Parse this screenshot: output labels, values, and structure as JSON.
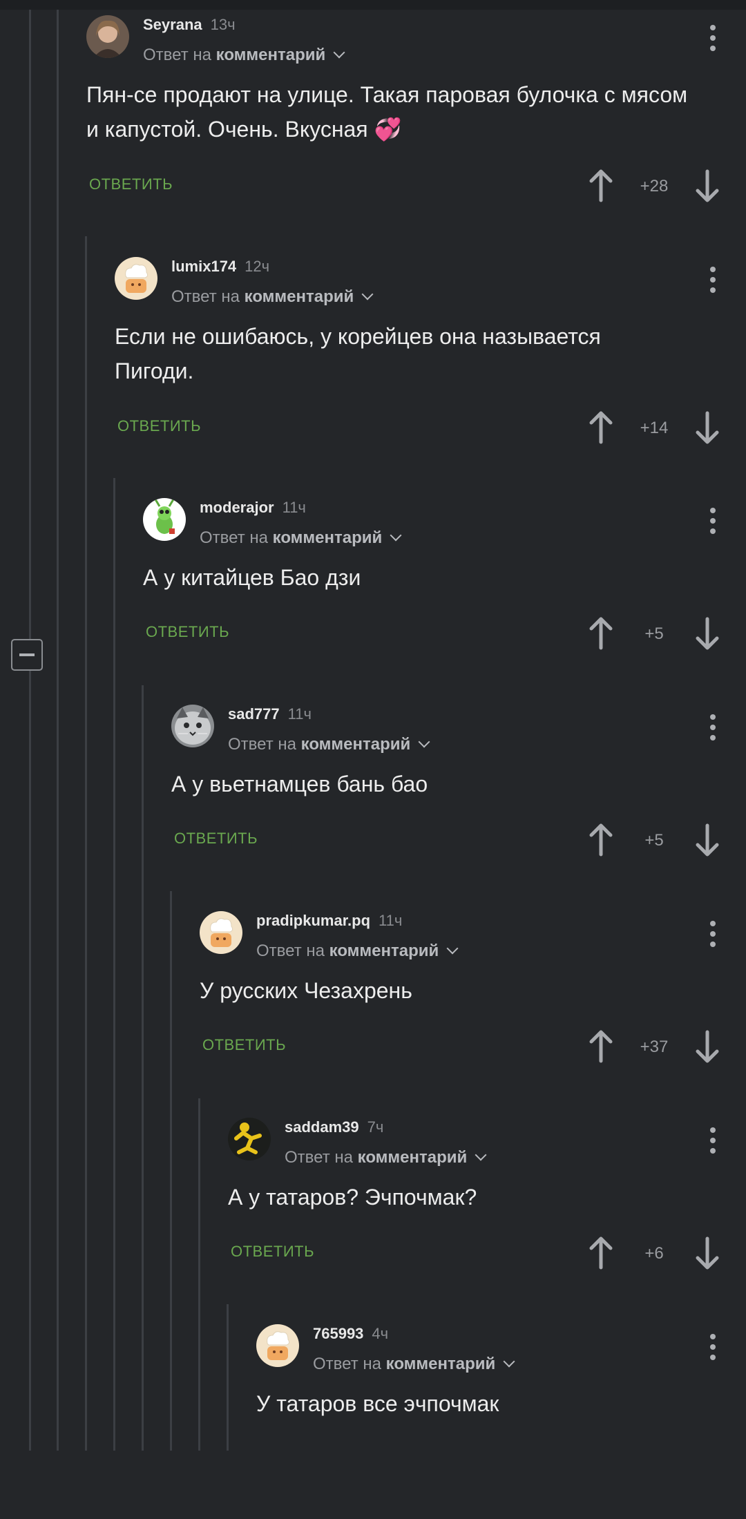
{
  "ui": {
    "reply_prefix": "Ответ на",
    "reply_target": "комментарий",
    "reply_action": "ОТВЕТИТЬ"
  },
  "comments": [
    {
      "username": "Seyrana",
      "time": "13ч",
      "text": "Пян-се продают на улице. Такая паровая булочка с мясом и капустой. Очень. Вкусная 💞",
      "score": "+28",
      "avatar": "woman-photo"
    },
    {
      "username": "lumix174",
      "time": "12ч",
      "text": "Если не ошибаюсь, у корейцев она называется Пигоди.",
      "score": "+14",
      "avatar": "default-chef"
    },
    {
      "username": "moderajor",
      "time": "11ч",
      "text": "А у китайцев Бао дзи",
      "score": "+5",
      "avatar": "green-bug"
    },
    {
      "username": "sad777",
      "time": "11ч",
      "text": "А у вьетнамцев бань бао",
      "score": "+5",
      "avatar": "cat-photo"
    },
    {
      "username": "pradipkumar.pq",
      "time": "11ч",
      "text": "У русских Чезахрень",
      "score": "+37",
      "avatar": "default-chef"
    },
    {
      "username": "saddam39",
      "time": "7ч",
      "text": "А у татаров? Эчпочмак?",
      "score": "+6",
      "avatar": "yellow-figure"
    },
    {
      "username": "765993",
      "time": "4ч",
      "text": "У татаров все эчпочмак",
      "score": "",
      "avatar": "default-chef"
    }
  ],
  "colors": {
    "background": "#242629",
    "reply_action": "#6aa84f",
    "thread_line": "#3c3f44"
  }
}
